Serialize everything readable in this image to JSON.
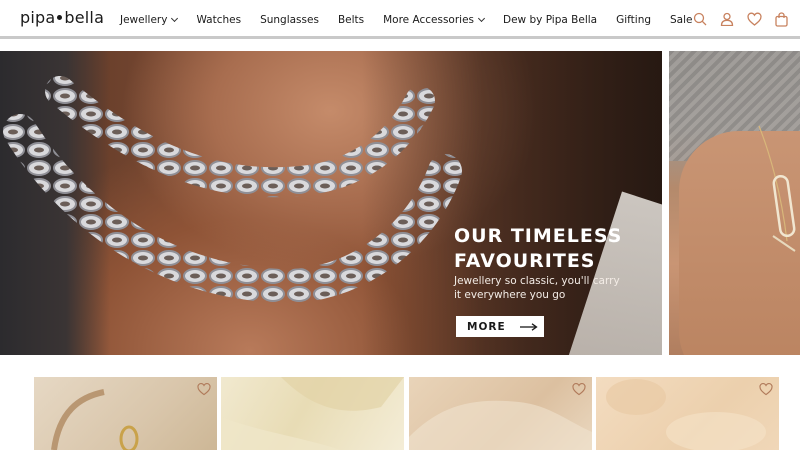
{
  "header": {
    "logo_left": "pipa",
    "logo_right": "bella",
    "nav": [
      {
        "label": "Jewellery",
        "has_dropdown": true
      },
      {
        "label": "Watches",
        "has_dropdown": false
      },
      {
        "label": "Sunglasses",
        "has_dropdown": false
      },
      {
        "label": "Belts",
        "has_dropdown": false
      },
      {
        "label": "More Accessories",
        "has_dropdown": true
      },
      {
        "label": "Dew by Pipa Bella",
        "has_dropdown": false
      },
      {
        "label": "Gifting",
        "has_dropdown": false
      },
      {
        "label": "Sale",
        "has_dropdown": false
      }
    ],
    "icons": [
      "search-icon",
      "account-icon",
      "wishlist-icon",
      "bag-icon"
    ],
    "icon_color": "#c8825f"
  },
  "hero": {
    "title_line1": "OUR TIMELESS",
    "title_line2": "FAVOURITES",
    "subtitle_line1": "Jewellery so classic, you'll carry",
    "subtitle_line2": "it everywhere you go",
    "button_label": "MORE"
  },
  "products": [
    {
      "wishlist_icon": "heart-outline-icon"
    },
    {
      "wishlist_icon": "heart-outline-icon"
    },
    {
      "wishlist_icon": "heart-outline-icon"
    },
    {
      "wishlist_icon": "heart-outline-icon"
    }
  ]
}
